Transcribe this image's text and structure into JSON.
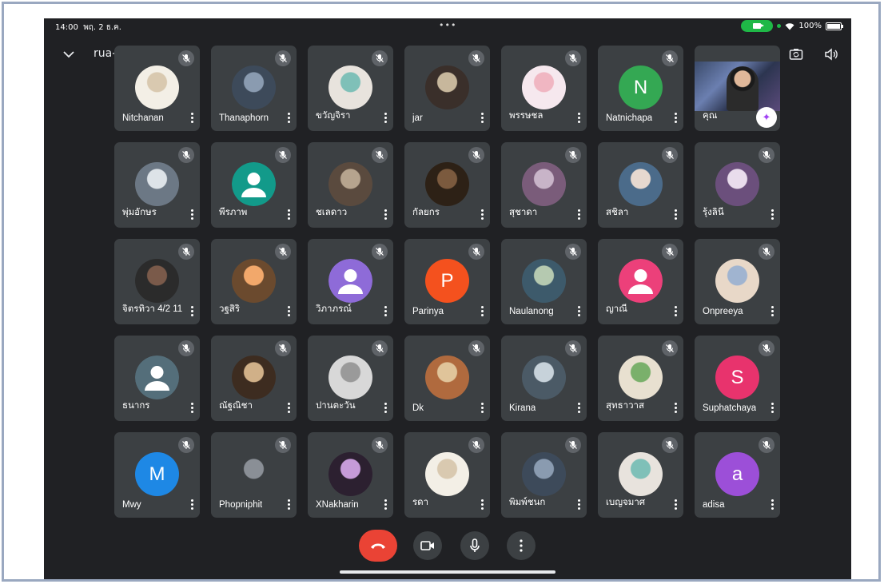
{
  "status_bar": {
    "time": "14:00",
    "date": "พฤ. 2 ธ.ค.",
    "battery": "100%",
    "battery_level": 1.0
  },
  "meeting": {
    "code": "rua-ragt-bcb"
  },
  "icons": {
    "collapse": "chevron-down-icon",
    "switch_camera": "switch-camera-icon",
    "speaker": "speaker-icon",
    "muted": "mic-off-icon",
    "more": "more-vert-icon",
    "effects": "sparkle-effects-icon"
  },
  "colors": {
    "background": "#202124",
    "tile": "#3c4043",
    "end_call": "#ea4335",
    "camera_active": "#1fb847"
  },
  "participants": [
    {
      "name": "Nitchanan",
      "avatar": "photo"
    },
    {
      "name": "Thanaphorn",
      "avatar": "photo"
    },
    {
      "name": "ขวัญจิรา",
      "avatar": "photo"
    },
    {
      "name": "jar",
      "avatar": "photo"
    },
    {
      "name": "พรรษชล",
      "avatar": "photo"
    },
    {
      "name": "Natnichapa",
      "avatar": "N",
      "color": "#34a853"
    },
    {
      "name": "คุณ",
      "avatar": "self-video"
    },
    {
      "name": "พุ่มอักษร",
      "avatar": "photo"
    },
    {
      "name": "พีรภาพ",
      "avatar": "default",
      "color": "#129a8a"
    },
    {
      "name": "ชเลดาว",
      "avatar": "photo"
    },
    {
      "name": "กัลยกร",
      "avatar": "photo"
    },
    {
      "name": "สุชาดา",
      "avatar": "photo"
    },
    {
      "name": "สชิลา",
      "avatar": "photo"
    },
    {
      "name": "รุ้งลินี",
      "avatar": "photo"
    },
    {
      "name": "จิตรทิวา 4/2 11",
      "avatar": "photo"
    },
    {
      "name": "วฐสิริ",
      "avatar": "photo"
    },
    {
      "name": "วิภาภรณ์",
      "avatar": "default",
      "color": "#8e6bd8"
    },
    {
      "name": "Parinya",
      "avatar": "P",
      "color": "#f4511e"
    },
    {
      "name": "Naulanong",
      "avatar": "photo"
    },
    {
      "name": "ญาณี",
      "avatar": "default",
      "color": "#ec407a"
    },
    {
      "name": "Onpreeya",
      "avatar": "photo"
    },
    {
      "name": "ธนากร",
      "avatar": "default",
      "color": "#546e7a"
    },
    {
      "name": "ณัฐณิชา",
      "avatar": "photo"
    },
    {
      "name": "ปานตะวัน",
      "avatar": "photo"
    },
    {
      "name": "Dk",
      "avatar": "photo"
    },
    {
      "name": "Kirana",
      "avatar": "photo"
    },
    {
      "name": "สุทธาวาส",
      "avatar": "photo"
    },
    {
      "name": "Suphatchaya",
      "avatar": "S",
      "color": "#e8336d"
    },
    {
      "name": "Mwy",
      "avatar": "M",
      "color": "#1e88e5"
    },
    {
      "name": "Phopniphit",
      "avatar": "photo"
    },
    {
      "name": "XNakharin",
      "avatar": "photo"
    },
    {
      "name": "รดา",
      "avatar": "photo"
    },
    {
      "name": "พิมพ์ชนก",
      "avatar": "photo"
    },
    {
      "name": "เบญจมาศ",
      "avatar": "photo"
    },
    {
      "name": "adisa",
      "avatar": "a",
      "color": "#9c4fd8"
    }
  ],
  "controls": [
    {
      "id": "end-call",
      "icon": "end-call-icon"
    },
    {
      "id": "camera",
      "icon": "camera-icon"
    },
    {
      "id": "microphone",
      "icon": "mic-icon"
    },
    {
      "id": "more-options",
      "icon": "more-vert-icon"
    }
  ]
}
